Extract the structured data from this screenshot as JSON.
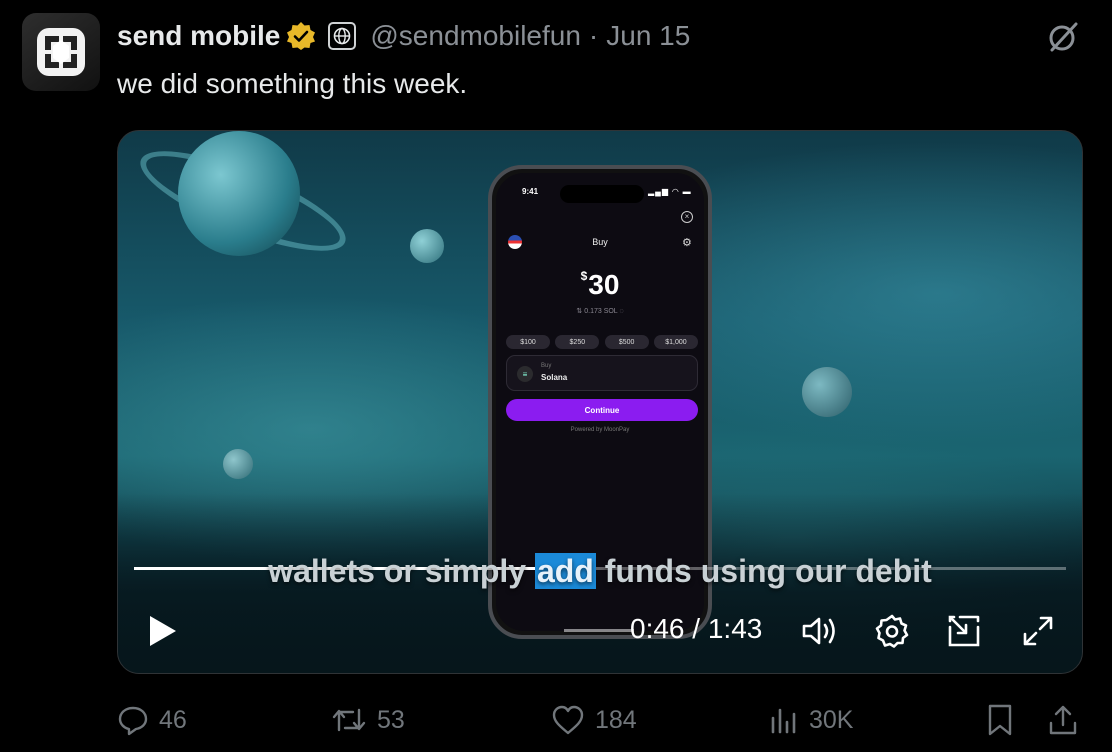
{
  "tweet": {
    "author_name": "send mobile",
    "handle": "@sendmobilefun",
    "separator": "·",
    "date": "Jun 15",
    "text": "we did something this week."
  },
  "video": {
    "phone": {
      "status_time": "9:41",
      "screen_title": "Buy",
      "currency_symbol": "$",
      "amount": "30",
      "sol_estimate": "0.173 SOL",
      "presets": [
        "$100",
        "$250",
        "$500",
        "$1,000"
      ],
      "asset_kicker": "Buy",
      "asset_name": "Solana",
      "continue_label": "Continue",
      "powered_by": "Powered by MoonPay"
    },
    "caption_before": "wallets or simply ",
    "caption_highlight": "add",
    "caption_after": " funds using our debit",
    "current_time": "0:46",
    "time_separator": " / ",
    "duration": "1:43",
    "progress_fraction": 0.446
  },
  "actions": {
    "replies": "46",
    "reposts": "53",
    "likes": "184",
    "views": "30K"
  },
  "colors": {
    "background": "#000000",
    "text": "#e7e9ea",
    "muted": "#71767b",
    "verified": "#e8b829",
    "continue_button": "#8b1cf0",
    "caption_highlight": "#1b8ad8"
  },
  "icons": [
    "verified-badge-icon",
    "affiliate-globe-icon",
    "grok-icon",
    "play-icon",
    "volume-icon",
    "settings-icon",
    "pip-icon",
    "fullscreen-icon",
    "reply-icon",
    "repost-icon",
    "like-icon",
    "views-icon",
    "bookmark-icon",
    "share-icon"
  ]
}
